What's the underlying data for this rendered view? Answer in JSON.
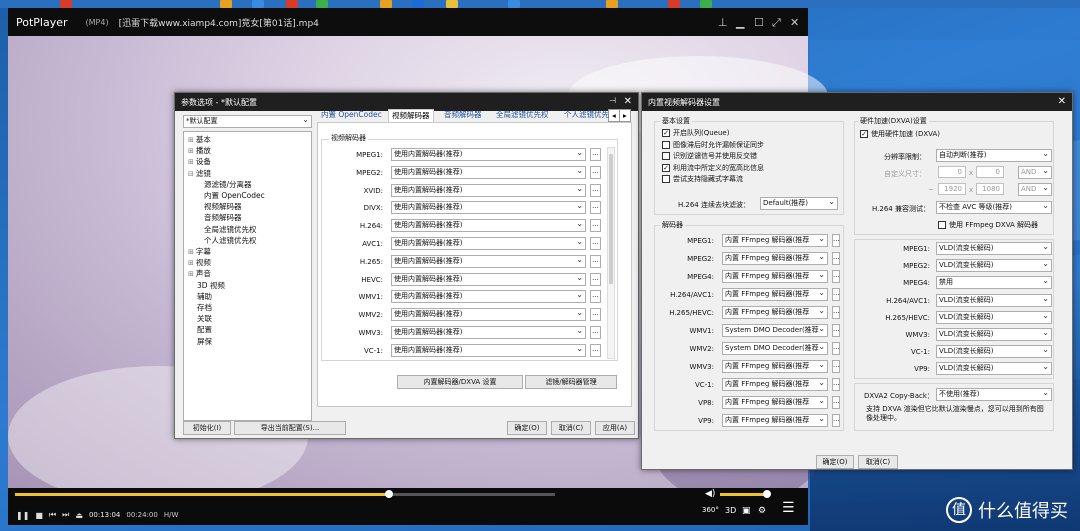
{
  "player": {
    "app_name": "PotPlayer",
    "format": "(MP4)",
    "filename": "[迅雷下载www.xiamp4.com]竞女[第01话].mp4",
    "time_current": "00:13:04",
    "time_total": "00:24:00",
    "decoder": "H/W",
    "seek_progress": 0.69,
    "right_controls": {
      "deg360": "360°",
      "d3": "3D"
    }
  },
  "prefs": {
    "title": "参数选项 - *默认配置",
    "profile": "*默认配置",
    "tree": [
      "基本",
      "播放",
      "设备",
      "滤镜",
      "源滤镜/分离器",
      "内置 OpenCodec",
      "视频解码器",
      "音频解码器",
      "全局滤镜优先权",
      "个人滤镜优先权",
      "字幕",
      "视频",
      "声音",
      "3D 视频",
      "辅助",
      "存档",
      "关联",
      "配置",
      "屏保"
    ],
    "tabs": [
      "内置 OpenCodec",
      "视频解码器",
      "音频解码器",
      "全局滤镜优先权",
      "个人滤镜优先"
    ],
    "group_label": "视频解码器",
    "codecs": [
      {
        "name": "MPEG1:",
        "value": "使用内置解码器(推荐)"
      },
      {
        "name": "MPEG2:",
        "value": "使用内置解码器(推荐)"
      },
      {
        "name": "XVID:",
        "value": "使用内置解码器(推荐)"
      },
      {
        "name": "DIVX:",
        "value": "使用内置解码器(推荐)"
      },
      {
        "name": "H.264:",
        "value": "使用内置解码器(推荐)"
      },
      {
        "name": "AVC1:",
        "value": "使用内置解码器(推荐)"
      },
      {
        "name": "H.265:",
        "value": "使用内置解码器(推荐)"
      },
      {
        "name": "HEVC:",
        "value": "使用内置解码器(推荐)"
      },
      {
        "name": "WMV1:",
        "value": "使用内置解码器(推荐)"
      },
      {
        "name": "WMV2:",
        "value": "使用内置解码器(推荐)"
      },
      {
        "name": "WMV3:",
        "value": "使用内置解码器(推荐)"
      },
      {
        "name": "VC-1:",
        "value": "使用内置解码器(推荐)"
      }
    ],
    "dots": "...",
    "btn_dxva": "内置解码器/DXVA 设置",
    "btn_filter": "滤镜/解码器管理",
    "btn_init": "初始化(I)",
    "btn_export": "导出当前配置(S)...",
    "btn_ok": "确定(O)",
    "btn_cancel": "取消(C)",
    "btn_apply": "应用(A)"
  },
  "decoder": {
    "title": "内置视频解码器设置",
    "basic_label": "基本设置",
    "checks": [
      {
        "label": "开启队列(Queue)",
        "checked": true
      },
      {
        "label": "图像滞后时允许漏帧保证同步",
        "checked": false
      },
      {
        "label": "识别逆谴信号并使用反交错",
        "checked": false
      },
      {
        "label": "利用流中所定义的宽高比信息",
        "checked": true
      },
      {
        "label": "尝试支持隐藏式字幕流",
        "checked": false
      }
    ],
    "h264_filter_label": "H.264 连续去块滤波：",
    "h264_filter_value": "Default(推荐)",
    "decoders_label": "解码器",
    "decoders": [
      {
        "name": "MPEG1:",
        "value": "内置 FFmpeg 解码器(推荐"
      },
      {
        "name": "MPEG2:",
        "value": "内置 FFmpeg 解码器(推荐"
      },
      {
        "name": "MPEG4:",
        "value": "内置 FFmpeg 解码器(推荐"
      },
      {
        "name": "H.264/AVC1:",
        "value": "内置 FFmpeg 解码器(推荐"
      },
      {
        "name": "H.265/HEVC:",
        "value": "内置 FFmpeg 解码器(推荐"
      },
      {
        "name": "WMV1:",
        "value": "System DMO Decoder(推荐"
      },
      {
        "name": "WMV2:",
        "value": "System DMO Decoder(推荐"
      },
      {
        "name": "WMV3:",
        "value": "内置 FFmpeg 解码器(推荐"
      },
      {
        "name": "VC-1:",
        "value": "内置 FFmpeg 解码器(推荐"
      },
      {
        "name": "VP8:",
        "value": "内置 FFmpeg 解码器(推荐"
      },
      {
        "name": "VP9:",
        "value": "内置 FFmpeg 解码器(推荐"
      }
    ],
    "hw_label": "硬件加速(DXVA)设置",
    "hw_check": "使用硬件加速 (DXVA)",
    "res_label": "分辨率限制：",
    "res_value": "自动判断(推荐)",
    "custom_label": "自定义尺寸：",
    "w0": "0",
    "h0": "0",
    "w1": "1920",
    "h1": "1080",
    "x": "x",
    "dash": "~",
    "and": "AND",
    "h264_compat_label": "H.264 兼容测试：",
    "h264_compat_value": "不检查 AVC 等级(推荐)",
    "ffmpeg_dxva": "使用 FFmpeg DXVA 解码器",
    "hw": [
      {
        "name": "MPEG1:",
        "value": "VLD(流变长解码)"
      },
      {
        "name": "MPEG2:",
        "value": "VLD(流变长解码)"
      },
      {
        "name": "MPEG4:",
        "value": "禁用"
      },
      {
        "name": "H.264/AVC1:",
        "value": "VLD(流变长解码)"
      },
      {
        "name": "H.265/HEVC:",
        "value": "VLD(流变长解码)"
      },
      {
        "name": "WMV3:",
        "value": "VLD(流变长解码)"
      },
      {
        "name": "VC-1:",
        "value": "VLD(流变长解码)"
      },
      {
        "name": "VP9:",
        "value": "VLD(流变长解码)"
      }
    ],
    "copyback_label": "DXVA2 Copy-Back：",
    "copyback_value": "不使用(推荐)",
    "note": "支持 DXVA 渲染但它比默认渲染慢点，您可以用到所有图像处理中。",
    "btn_ok": "确定(O)",
    "btn_cancel": "取消(C)"
  },
  "watermark": {
    "text": "什么值得买",
    "symbol": "值"
  }
}
